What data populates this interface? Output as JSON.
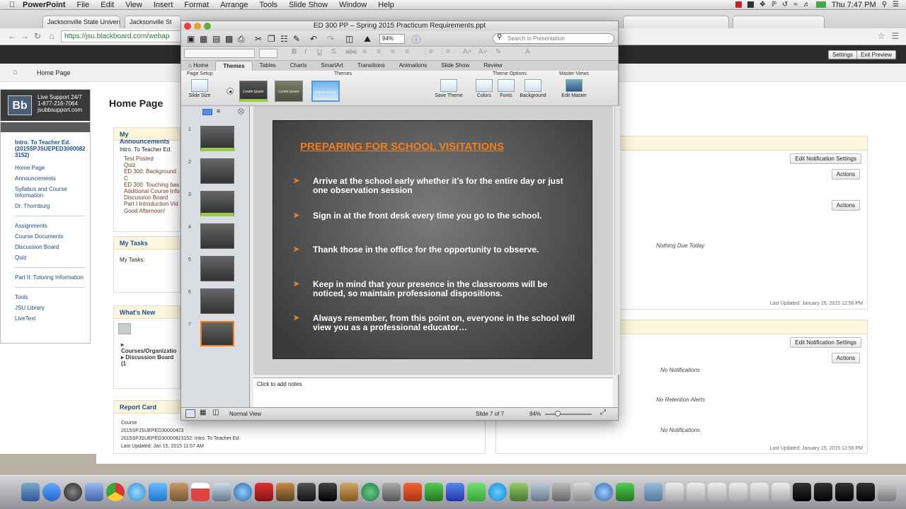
{
  "menubar": {
    "app": "PowerPoint",
    "items": [
      "File",
      "Edit",
      "View",
      "Insert",
      "Format",
      "Arrange",
      "Tools",
      "Slide Show",
      "Window",
      "Help"
    ],
    "clock": "Thu 7:47 PM"
  },
  "browser": {
    "tabs": [
      "Jacksonville State Univers",
      "Jacksonville St"
    ],
    "url": "https://jsu.blackboard.com/webap",
    "preview_buttons": [
      "Settings",
      "Exit Preview"
    ]
  },
  "breadcrumb": {
    "label": "Home Page"
  },
  "leftnav": {
    "support": [
      "Live Support 24/7",
      "1-877-216-7064",
      "jsubbsupport.com"
    ],
    "course_title": "Intro. To Teacher Ed. (2015SPJSUEPED3000082 3152)",
    "links_a": [
      "Home Page",
      "Announcements",
      "Syllabus and Course Information",
      "Dr. Thornburg"
    ],
    "links_b": [
      "Assignments",
      "Course Documents",
      "Discussion Board",
      "Quiz"
    ],
    "links_c": [
      "Part II: Tutoring Information"
    ],
    "links_d": [
      "Tools",
      "JSU Library",
      "LiveText"
    ]
  },
  "main": {
    "page_title": "Home Page",
    "announcements": {
      "title": "My Announcements",
      "course": "Intro. To Teacher Ed.",
      "items": [
        "Test Posted",
        "Quiz",
        "ED 300: Background C",
        "ED 300: Touching bas",
        "Additional Course Info",
        "Discussion Board",
        "Part I Introduction Vid",
        "Good Afternoon!"
      ]
    },
    "tasks": {
      "title": "My Tasks",
      "text": "My Tasks:"
    },
    "whats_new": {
      "title": "What's New",
      "items": [
        "Courses/Organizatio",
        "Discussion Board (1"
      ]
    },
    "report_card": {
      "title": "Report Card",
      "lines": [
        "Course",
        "2015SPJSUEPED30000423",
        "2015SPJSUEPED30000823152: Intro. To Teacher Ed.",
        "Last Updated: Jan 15, 2015 11:57 AM"
      ]
    },
    "right": {
      "edit_notif": "Edit Notification Settings",
      "actions": "Actions",
      "nothing_due": "Nothing Due Today",
      "last_updated": "Last Updated: January 15, 2015 12:56 PM",
      "no_notifications": "No Notifications",
      "no_retention": "No Retention Alerts"
    }
  },
  "ppt": {
    "title": "ED 300 PP – Spring 2015 Practicum Requirements.ppt",
    "zoom": "94%",
    "search_placeholder": "Search in Presentation",
    "ribbon_tabs": [
      "Home",
      "Themes",
      "Tables",
      "Charts",
      "SmartArt",
      "Transitions",
      "Animations",
      "Slide Show",
      "Review"
    ],
    "active_tab": "Themes",
    "groups": {
      "page_setup": "Page Setup",
      "themes": "Themes",
      "theme_options": "Theme Options",
      "master_views": "Master Views"
    },
    "buttons": {
      "slide_size": "Slide Size",
      "save_theme": "Save Theme",
      "colors": "Colors",
      "fonts": "Fonts",
      "background": "Background",
      "edit_master": "Edit Master"
    },
    "theme_thumb_text": [
      "Lorem Ipsum",
      "Lorem Ipsum",
      "Lorem Ipsum"
    ],
    "slide_numbers": [
      "1",
      "2",
      "3",
      "4",
      "5",
      "6",
      "7"
    ],
    "slide": {
      "title": "PREPARING FOR SCHOOL VISITATIONS",
      "bullets": [
        "Arrive at the school early whether it’s for the entire day or just one observation session",
        "Sign in at the front desk every time you go to the school.",
        "Thank those in the office for the opportunity to observe.",
        "Keep in mind that your presence in the classrooms will be noticed, so maintain professional dispositions.",
        "Always remember, from this point on, everyone in the school will view you as a professional educator…"
      ]
    },
    "notes_placeholder": "Click to add notes",
    "status": {
      "view": "Normal View",
      "slide": "Slide 7 of 7",
      "zoom": "94%"
    }
  }
}
